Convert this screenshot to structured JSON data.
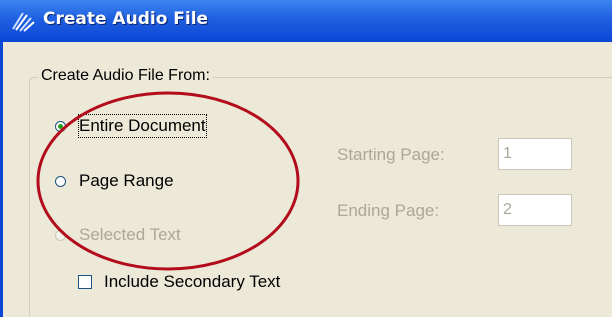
{
  "window": {
    "title": "Create Audio File"
  },
  "group": {
    "label": "Create Audio File From:"
  },
  "options": [
    {
      "label": "Entire Document",
      "selected": true,
      "enabled": true
    },
    {
      "label": "Page Range",
      "selected": false,
      "enabled": true
    },
    {
      "label": "Selected Text",
      "selected": false,
      "enabled": false
    }
  ],
  "page_range": {
    "start_label": "Starting Page:",
    "start_value": "1",
    "end_label": "Ending Page:",
    "end_value": "2"
  },
  "secondary": {
    "label": "Include Secondary Text",
    "checked": false
  },
  "colors": {
    "titlebar": "#0b47d6",
    "dialog": "#ece9d8",
    "annotation": "#b30c1c",
    "disabled_text": "#aca899"
  }
}
